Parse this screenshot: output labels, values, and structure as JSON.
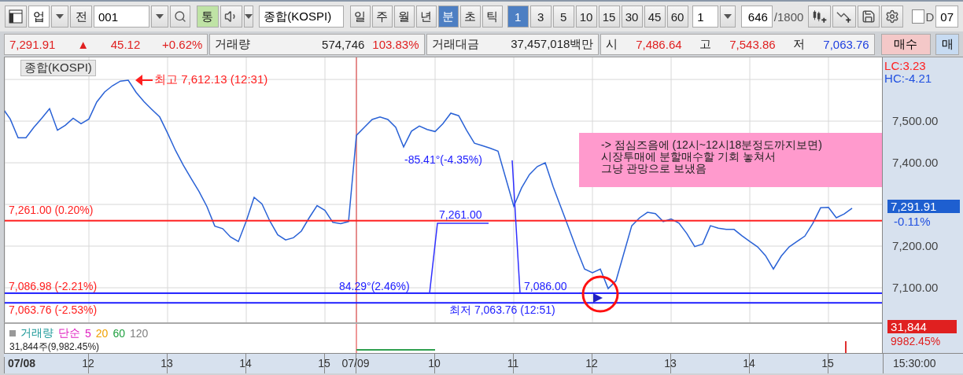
{
  "toolbar": {
    "market": "업",
    "prev_button": "전",
    "code_field": "001",
    "link_toggle": {
      "label": "통",
      "on": true
    },
    "name_field": "종합(KOSPI)",
    "periods": [
      {
        "label": "일",
        "selected": false
      },
      {
        "label": "주",
        "selected": false
      },
      {
        "label": "월",
        "selected": false
      },
      {
        "label": "년",
        "selected": false
      },
      {
        "label": "분",
        "selected": true
      },
      {
        "label": "초",
        "selected": false
      },
      {
        "label": "틱",
        "selected": false
      }
    ],
    "intervals": [
      {
        "label": "1",
        "selected": true
      },
      {
        "label": "3",
        "selected": false
      },
      {
        "label": "5",
        "selected": false
      },
      {
        "label": "10",
        "selected": false
      },
      {
        "label": "15",
        "selected": false
      },
      {
        "label": "30",
        "selected": false
      },
      {
        "label": "45",
        "selected": false
      },
      {
        "label": "60",
        "selected": false
      }
    ],
    "count_select": "1",
    "bars_field": "646",
    "bars_total": "/1800",
    "d_checkbox": {
      "label": "D",
      "checked": false
    },
    "date_field": "07"
  },
  "info": {
    "price": "7,291.91",
    "arrow": "▲",
    "change": "45.12",
    "rate": "+0.62%",
    "volume_label": "거래량",
    "volume": "574,746",
    "volume_rate": "103.83%",
    "amount_label": "거래대금",
    "amount": "37,457,018백만",
    "open_label": "시",
    "open": "7,486.64",
    "high_label": "고",
    "high": "7,543.86",
    "low_label": "저",
    "low": "7,063.76",
    "buy": "매수",
    "sell": "매"
  },
  "chart": {
    "lc": "LC:3.23",
    "hc": "HC:-4.21",
    "price_badge": "7,291.91",
    "change": "-0.11%",
    "annotations": [
      {
        "kind": "high",
        "text": "최고 7,612.13 (12:31)"
      },
      {
        "kind": "angle",
        "text": "-85.41°(-4.35%)"
      },
      {
        "kind": "angle",
        "text": "84.29°(2.46%)"
      },
      {
        "kind": "level",
        "text": "7,261.00"
      },
      {
        "kind": "level",
        "text": "7,086.00"
      },
      {
        "kind": "low",
        "text": "최저 7,063.76 (12:51)"
      }
    ],
    "note": [
      "-> 점심즈음에 (12시~12시18분정도까지보면)",
      "시장투매에 분할매수할 기회 놓쳐서",
      "그냥 관망으로 보냈음"
    ],
    "chart_data": {
      "type": "line",
      "title": "종합(KOSPI)",
      "grid": true,
      "ylim": [
        7017,
        7653
      ],
      "ref_lines": [
        {
          "axis": "y",
          "value": 7261,
          "label": "7,261.00 (0.20%)",
          "color": "#ff2020"
        },
        {
          "axis": "y",
          "value": 7086.98,
          "label": "7,086.98 (-2.21%)",
          "color": "#2020ff"
        },
        {
          "axis": "y",
          "value": 7063.76,
          "label": "7,063.76 (-2.53%)",
          "color": "#2020ff"
        }
      ],
      "categories": [
        null,
        null,
        null,
        null,
        null,
        null,
        null,
        null,
        null,
        null,
        null,
        "12",
        null,
        null,
        null,
        null,
        null,
        null,
        null,
        null,
        null,
        "13",
        null,
        null,
        null,
        null,
        null,
        null,
        null,
        null,
        null,
        "14",
        null,
        null,
        null,
        null,
        null,
        null,
        null,
        null,
        null,
        "15",
        null,
        null,
        null,
        "07/09",
        null,
        null,
        null,
        null,
        null,
        null,
        null,
        null,
        null,
        "10",
        null,
        null,
        null,
        null,
        null,
        null,
        null,
        null,
        null,
        "11",
        null,
        null,
        null,
        null,
        null,
        null,
        null,
        null,
        null,
        "12",
        null,
        null,
        null,
        null,
        null,
        null,
        null,
        null,
        null,
        "13",
        null,
        null,
        null,
        null,
        null,
        null,
        null,
        null,
        null,
        "14",
        null,
        null,
        null,
        null,
        null,
        null,
        null,
        null,
        null,
        "15",
        null,
        null,
        null
      ],
      "yticks": [
        {
          "value": 7100,
          "label": "7,100.00"
        },
        {
          "value": 7200,
          "label": "7,200.00"
        },
        {
          "value": 7400,
          "label": "7,400.00"
        },
        {
          "value": 7500,
          "label": "7,500.00"
        }
      ],
      "series": [
        {
          "color": "#2a62d6",
          "values": [
            7532,
            7505,
            7460,
            7460,
            7485,
            7507,
            7530,
            7478,
            7490,
            7507,
            7494,
            7505,
            7546,
            7570,
            7585,
            7596,
            7598,
            7569,
            7547,
            7528,
            7510,
            7471,
            7430,
            7394,
            7362,
            7331,
            7295,
            7248,
            7242,
            7222,
            7211,
            7260,
            7317,
            7301,
            7260,
            7227,
            7215,
            7220,
            7236,
            7268,
            7297,
            7286,
            7257,
            7254,
            7259,
            7466,
            7485,
            7504,
            7510,
            7504,
            7485,
            7438,
            7476,
            7488,
            7480,
            7475,
            7494,
            7519,
            7513,
            7478,
            7447,
            7441,
            7435,
            7428,
            7362,
            7296,
            7340,
            7372,
            7391,
            7400,
            7343,
            7293,
            7243,
            7192,
            7145,
            7136,
            7145,
            7098,
            7117,
            7183,
            7249,
            7268,
            7281,
            7278,
            7259,
            7265,
            7255,
            7230,
            7199,
            7205,
            7249,
            7243,
            7240,
            7240,
            7225,
            7211,
            7198,
            7177,
            7145,
            7176,
            7198,
            7211,
            7224,
            7254,
            7292,
            7293,
            7268,
            7277,
            7291
          ]
        }
      ]
    }
  },
  "volume": {
    "legend": [
      {
        "text": "거래량",
        "color": "#1f9a9a"
      },
      {
        "text": "단순",
        "color": "#e020c0"
      },
      {
        "text": "5",
        "color": "#e020c0"
      },
      {
        "text": "20",
        "color": "#f0a000"
      },
      {
        "text": "60",
        "color": "#20a040"
      },
      {
        "text": "120",
        "color": "#808080"
      }
    ],
    "reading": "31,844주(9,982.45%)",
    "badge": "31,844",
    "rate": "9982.45%"
  },
  "start_date": "07/08",
  "current_time": "15:30:00"
}
